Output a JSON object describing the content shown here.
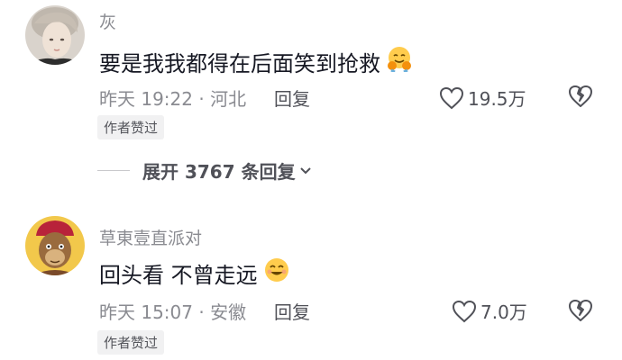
{
  "comments": [
    {
      "username": "灰",
      "text": "要是我我都得在后面笑到抢救",
      "emoji": "hugging-face-emoji",
      "time": "昨天 19:22",
      "location": "河北",
      "reply_label": "回复",
      "likes": "19.5万",
      "badge": "作者赞过",
      "expand_label": "展开 3767 条回复"
    },
    {
      "username": "草東壹直派对",
      "text": "回头看 不曾走远",
      "emoji": "smiling-face-emoji",
      "time": "昨天 15:07",
      "location": "安徽",
      "reply_label": "回复",
      "likes": "7.0万",
      "badge": "作者赞过"
    }
  ],
  "colors": {
    "text": "#161823",
    "secondary": "#8a8b91",
    "badge_bg": "#f1f1f2"
  }
}
